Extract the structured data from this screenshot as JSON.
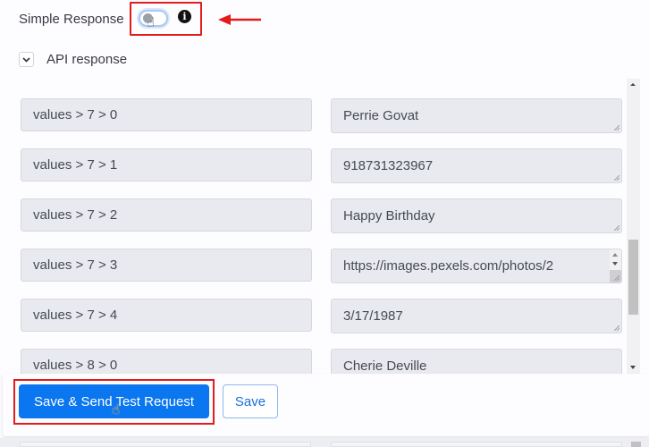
{
  "header": {
    "simple_response_label": "Simple Response",
    "simple_response_toggle_on": false,
    "api_response_label": "API response"
  },
  "rows": [
    {
      "key": "values > 7 > 0",
      "value": "Perrie Govat"
    },
    {
      "key": "values > 7 > 1",
      "value": "918731323967"
    },
    {
      "key": "values > 7 > 2",
      "value": "Happy Birthday"
    },
    {
      "key": "values > 7 > 3",
      "value": "https://images.pexels.com/photos/2"
    },
    {
      "key": "values > 7 > 4",
      "value": "3/17/1987"
    },
    {
      "key": "values > 8 > 0",
      "value": "Cherie Deville"
    }
  ],
  "footer": {
    "primary_label": "Save & Send Test Request",
    "secondary_label": "Save"
  },
  "colors": {
    "primary": "#0a76f0",
    "annotation_red": "#e31b1b",
    "field_bg": "#e9eaf0"
  },
  "icons": {
    "info": "i",
    "cursor": "☝"
  }
}
